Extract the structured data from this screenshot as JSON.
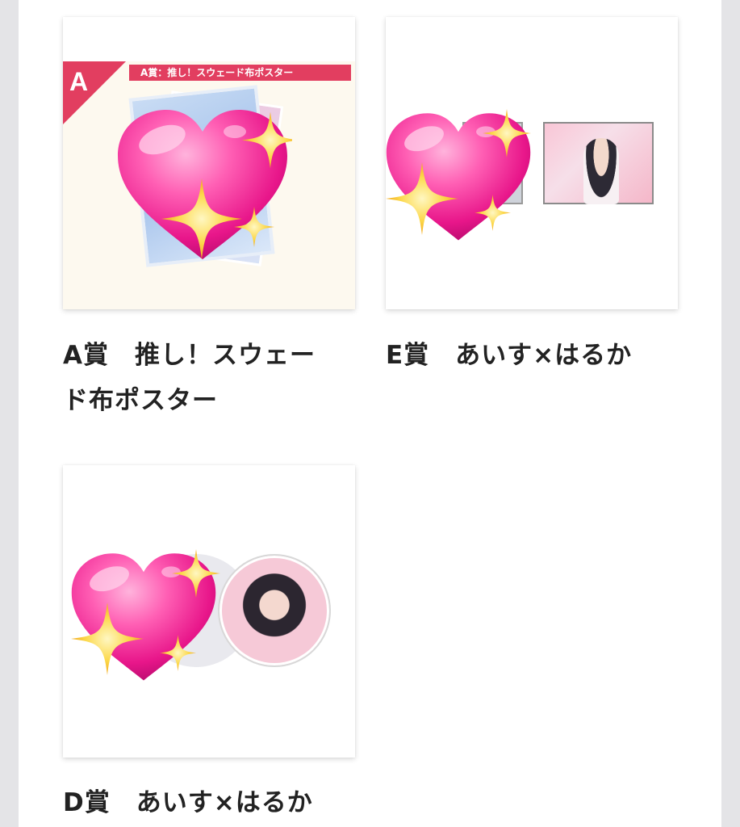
{
  "items": [
    {
      "name": "A賞　推し！スウェード布ポスター",
      "name_line1": "A賞　推し！スウェー",
      "name_line2": "ド布ポスター",
      "image": {
        "letter": "A",
        "banner_text": "A賞：推し！スウェード布ポスター",
        "overlay": "sparkling-heart-emoji"
      }
    },
    {
      "name": "E賞　あいす×はるか",
      "image": {
        "overlay": "sparkling-heart-emoji"
      }
    },
    {
      "name": "D賞　あいす×はるか",
      "image": {
        "overlay": "sparkling-heart-emoji"
      }
    }
  ],
  "colors": {
    "background": "#e4e4e7",
    "page": "#ffffff",
    "accent_red": "#e23e60",
    "heart_pink": "#f0449a",
    "sparkle_yellow": "#fbd346"
  }
}
